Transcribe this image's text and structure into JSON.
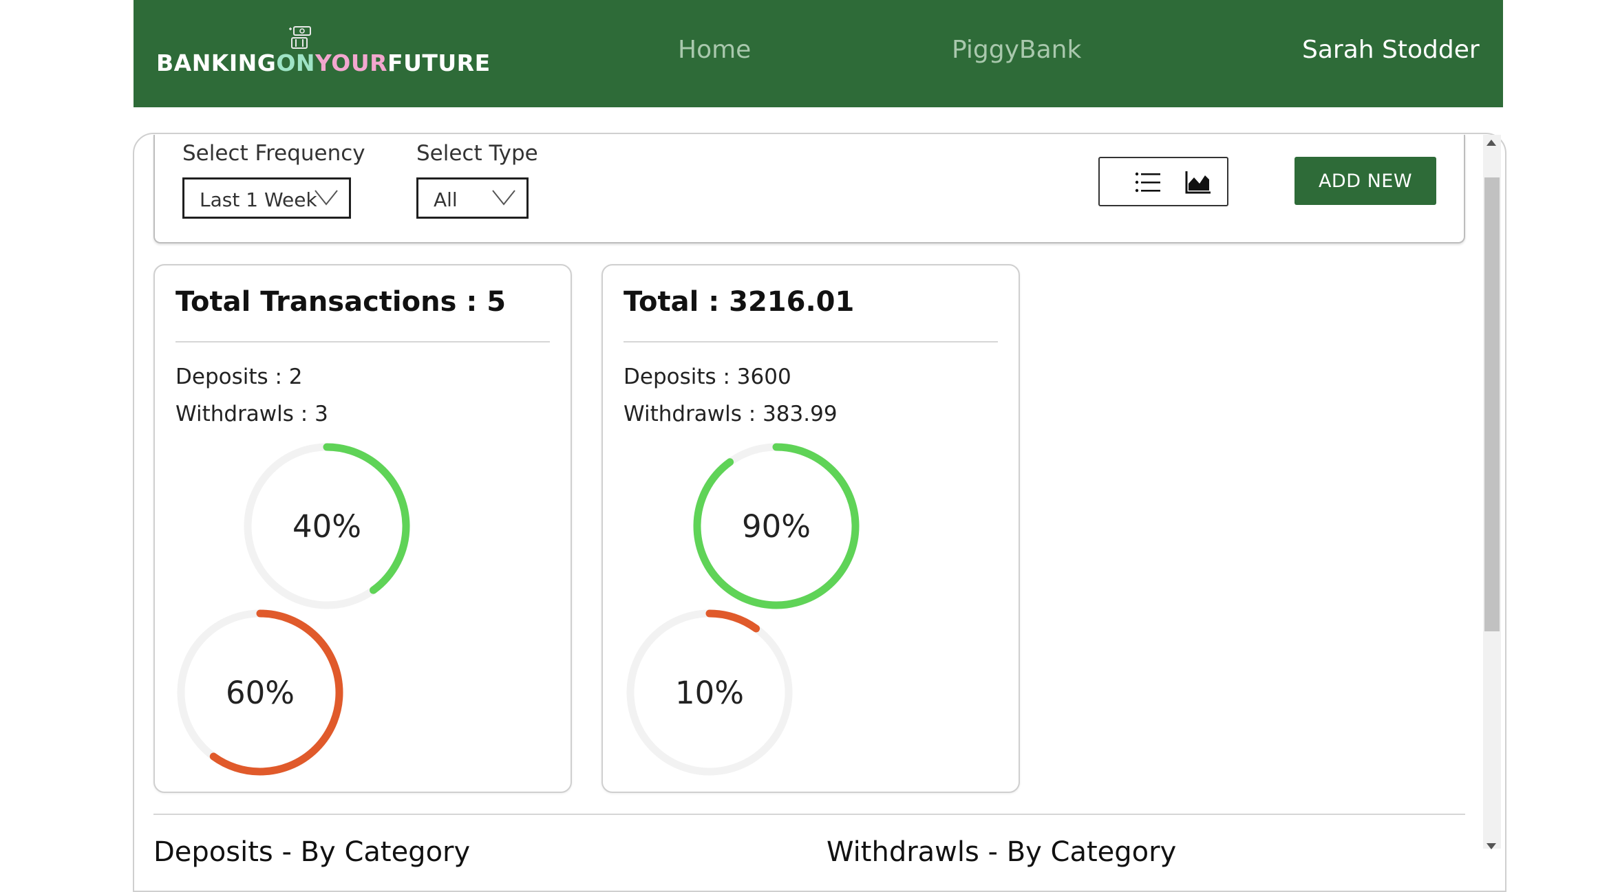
{
  "header": {
    "brand_part1": "BANKING",
    "brand_part2": "ON",
    "brand_part3": "YOUR",
    "brand_part4": "FUTURE",
    "nav": {
      "home": "Home",
      "piggybank": "PiggyBank",
      "user": "Sarah Stodder"
    }
  },
  "filters": {
    "frequency_label": "Select Frequency",
    "frequency_value": "Last 1 Week",
    "type_label": "Select Type",
    "type_value": "All",
    "add_new_label": "ADD NEW"
  },
  "summary": {
    "count_card": {
      "title": "Total Transactions : 5",
      "deposits_line": "Deposits : 2",
      "withdrawals_line": "Withdrawls : 3",
      "deposit_ring": {
        "percent": 40,
        "label": "40%",
        "color": "#5fd357"
      },
      "withdrawal_ring": {
        "percent": 60,
        "label": "60%",
        "color": "#e05a2b"
      }
    },
    "amount_card": {
      "title": "Total : 3216.01",
      "deposits_line": "Deposits : 3600",
      "withdrawals_line": "Withdrawls : 383.99",
      "deposit_ring": {
        "percent": 90,
        "label": "90%",
        "color": "#5fd357"
      },
      "withdrawal_ring": {
        "percent": 10,
        "label": "10%",
        "color": "#e05a2b"
      }
    }
  },
  "sections": {
    "deposits_title": "Deposits - By Category",
    "withdrawals_title": "Withdrawls - By Category"
  },
  "colors": {
    "primary": "#2e6b38",
    "deposit": "#5fd357",
    "withdrawal": "#e05a2b",
    "track": "#f2f2f2"
  }
}
